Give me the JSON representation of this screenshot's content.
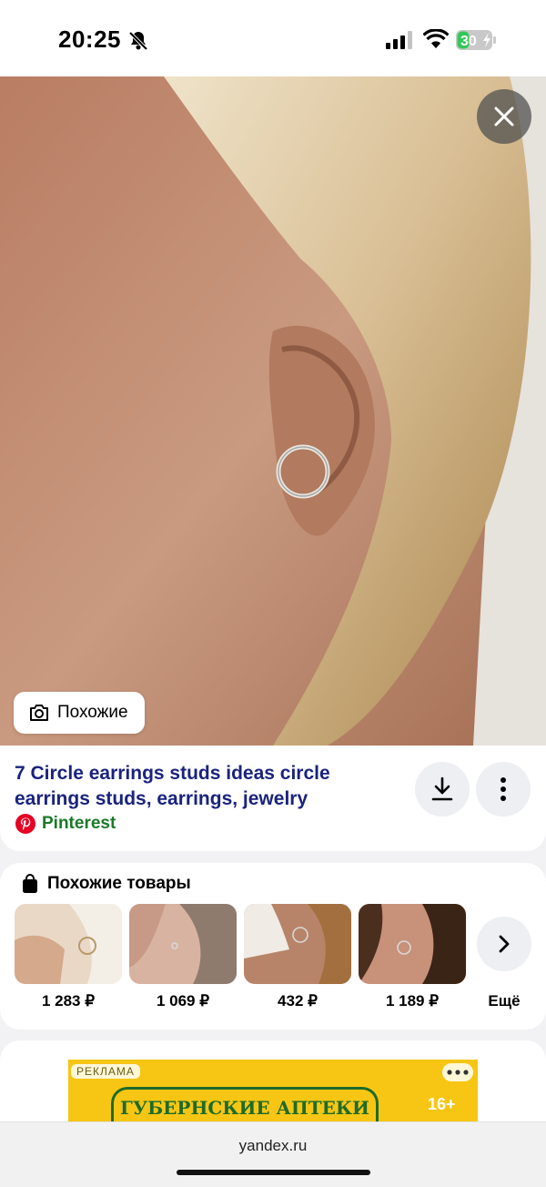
{
  "status_bar": {
    "time": "20:25",
    "battery_percent": "30"
  },
  "viewer": {
    "similar_button_label": "Похожие",
    "title": "7 Circle earrings studs ideas circle earrings studs, earrings, jewelry",
    "source": "Pinterest"
  },
  "products": {
    "heading": "Похожие товары",
    "items": [
      {
        "price": "1 283 ₽"
      },
      {
        "price": "1 069 ₽"
      },
      {
        "price": "432 ₽"
      },
      {
        "price": "1 189 ₽"
      }
    ],
    "more_label": "Ещё"
  },
  "ad": {
    "tag": "РЕКЛАМА",
    "brand": "ГУБЕРНСКИЕ АПТЕКИ",
    "age_rating": "16+"
  },
  "browser": {
    "url": "yandex.ru"
  },
  "colors": {
    "title": "#1a237e",
    "source": "#1b7a28",
    "pinterest": "#e60023",
    "ad_bg": "#f7c614",
    "ad_brand": "#1e6b2a"
  }
}
